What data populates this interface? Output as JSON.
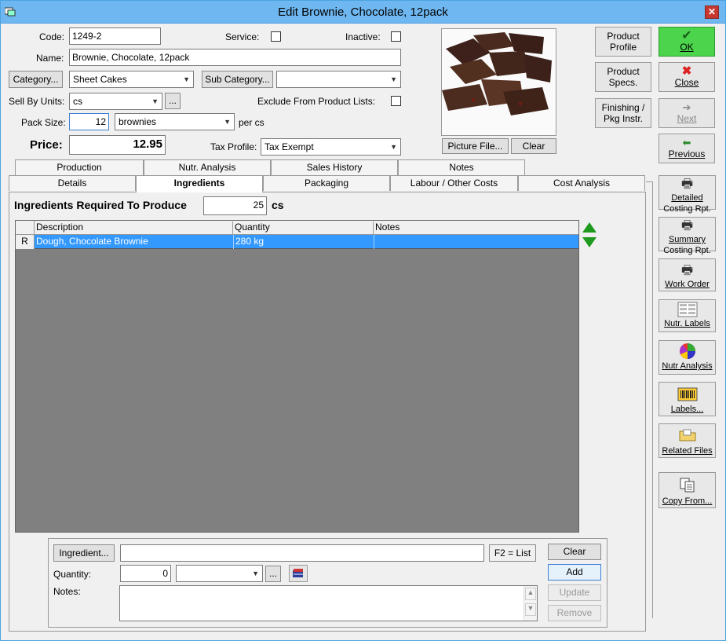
{
  "window": {
    "title": "Edit Brownie, Chocolate, 12pack"
  },
  "form": {
    "code_label": "Code:",
    "code_value": "1249-2",
    "service_label": "Service:",
    "inactive_label": "Inactive:",
    "name_label": "Name:",
    "name_value": "Brownie, Chocolate, 12pack",
    "category_button": "Category...",
    "category_value": "Sheet Cakes",
    "subcategory_button": "Sub Category...",
    "subcategory_value": "",
    "sell_by_units_label": "Sell By Units:",
    "sell_by_units_value": "cs",
    "ellipsis": "...",
    "exclude_label": "Exclude From Product Lists:",
    "pack_size_label": "Pack Size:",
    "pack_size_value": "12",
    "pack_unit_value": "brownies",
    "per_label": "per cs",
    "price_label": "Price:",
    "price_value": "12.95",
    "tax_profile_label": "Tax Profile:",
    "tax_profile_value": "Tax Exempt"
  },
  "picture": {
    "picture_file_button": "Picture File...",
    "clear_button": "Clear"
  },
  "right_buttons": {
    "product_profile": "Product Profile",
    "product_specs": "Product Specs.",
    "finishing": "Finishing / Pkg Instr.",
    "ok": "OK",
    "close": "Close",
    "next": "Next",
    "previous": "Previous"
  },
  "tabs_row1": [
    "Production",
    "Nutr. Analysis",
    "Sales History",
    "Notes"
  ],
  "tabs_row2": [
    "Details",
    "Ingredients",
    "Packaging",
    "Labour / Other Costs",
    "Cost Analysis"
  ],
  "ingredients": {
    "required_label": "Ingredients Required To Produce",
    "required_value": "25",
    "unit": "cs",
    "columns": [
      "Description",
      "Quantity",
      "Notes"
    ],
    "rows": [
      {
        "marker": "R",
        "description": "Dough, Chocolate Brownie",
        "quantity": "280 kg",
        "notes": ""
      }
    ]
  },
  "editor": {
    "ingredient_button": "Ingredient...",
    "ingredient_value": "",
    "f2_label": "F2 = List",
    "quantity_label": "Quantity:",
    "quantity_value": "0",
    "notes_label": "Notes:",
    "clear_button": "Clear",
    "add_button": "Add",
    "update_button": "Update",
    "remove_button": "Remove"
  },
  "side_reports": [
    {
      "line1": "Detailed",
      "line2": "Costing Rpt.",
      "icon": "printer-icon"
    },
    {
      "line1": "Summary",
      "line2": "Costing Rpt.",
      "icon": "printer-icon"
    },
    {
      "line1": "Work Order",
      "line2": "",
      "icon": "printer-icon"
    },
    {
      "line1": "Nutr. Labels",
      "line2": "",
      "icon": "label-sheet-icon"
    },
    {
      "line1": "Nutr Analysis",
      "line2": "",
      "icon": "pie-chart-icon"
    },
    {
      "line1": "Labels...",
      "line2": "",
      "icon": "barcode-icon"
    },
    {
      "line1": "Related Files",
      "line2": "",
      "icon": "folder-icon"
    },
    {
      "line1": "Copy From...",
      "line2": "",
      "icon": "copy-icon"
    }
  ],
  "colors": {
    "selected_row": "#3399ff",
    "grid_bg": "#808080",
    "ok_green": "#4cd44c"
  }
}
